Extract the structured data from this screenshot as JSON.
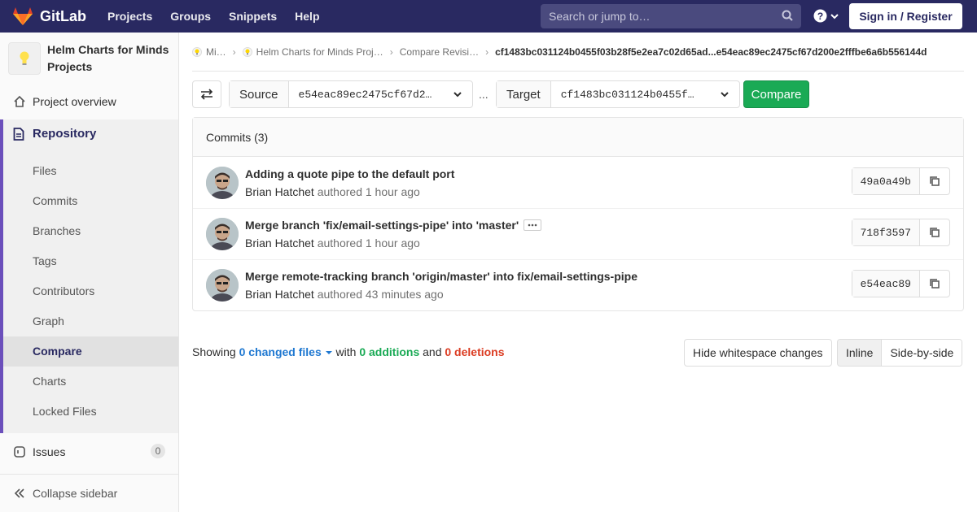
{
  "navbar": {
    "brand": "GitLab",
    "links": [
      "Projects",
      "Groups",
      "Snippets",
      "Help"
    ],
    "search_placeholder": "Search or jump to…",
    "signin_label": "Sign in / Register",
    "bg_color": "#292961"
  },
  "sidebar": {
    "project_name": "Helm Charts for Minds Projects",
    "overview": "Project overview",
    "repository": "Repository",
    "repo_items": [
      "Files",
      "Commits",
      "Branches",
      "Tags",
      "Contributors",
      "Graph",
      "Compare",
      "Charts",
      "Locked Files"
    ],
    "active_item": "Compare",
    "issues": "Issues",
    "issues_count": "0",
    "collapse": "Collapse sidebar"
  },
  "breadcrumbs": {
    "items": [
      "Mi…",
      "Helm Charts for Minds Proj…",
      "Compare Revisi…"
    ],
    "current": "cf1483bc031124b0455f03b28f5e2ea7c02d65ad...e54eac89ec2475cf67d200e2fffbe6a6b556144d"
  },
  "compare": {
    "source_label": "Source",
    "source_value": "e54eac89ec2475cf67d2…",
    "separator": "...",
    "target_label": "Target",
    "target_value": "cf1483bc031124b0455f…",
    "compare_label": "Compare"
  },
  "commits": {
    "header": "Commits (3)",
    "rows": [
      {
        "title": "Adding a quote pipe to the default port",
        "author": "Brian Hatchet",
        "time": "authored 1 hour ago",
        "sha": "49a0a49b",
        "has_ellipsis": false
      },
      {
        "title": "Merge branch 'fix/email-settings-pipe' into 'master'",
        "author": "Brian Hatchet",
        "time": "authored 1 hour ago",
        "sha": "718f3597",
        "has_ellipsis": true
      },
      {
        "title": "Merge remote-tracking branch 'origin/master' into fix/email-settings-pipe",
        "author": "Brian Hatchet",
        "time": "authored 43 minutes ago",
        "sha": "e54eac89",
        "has_ellipsis": false
      }
    ]
  },
  "diff": {
    "showing": "Showing",
    "changed_files": "0 changed files",
    "with": "with",
    "additions": "0 additions",
    "and": "and",
    "deletions": "0 deletions",
    "whitespace_btn": "Hide whitespace changes",
    "inline_btn": "Inline",
    "side_btn": "Side-by-side"
  }
}
